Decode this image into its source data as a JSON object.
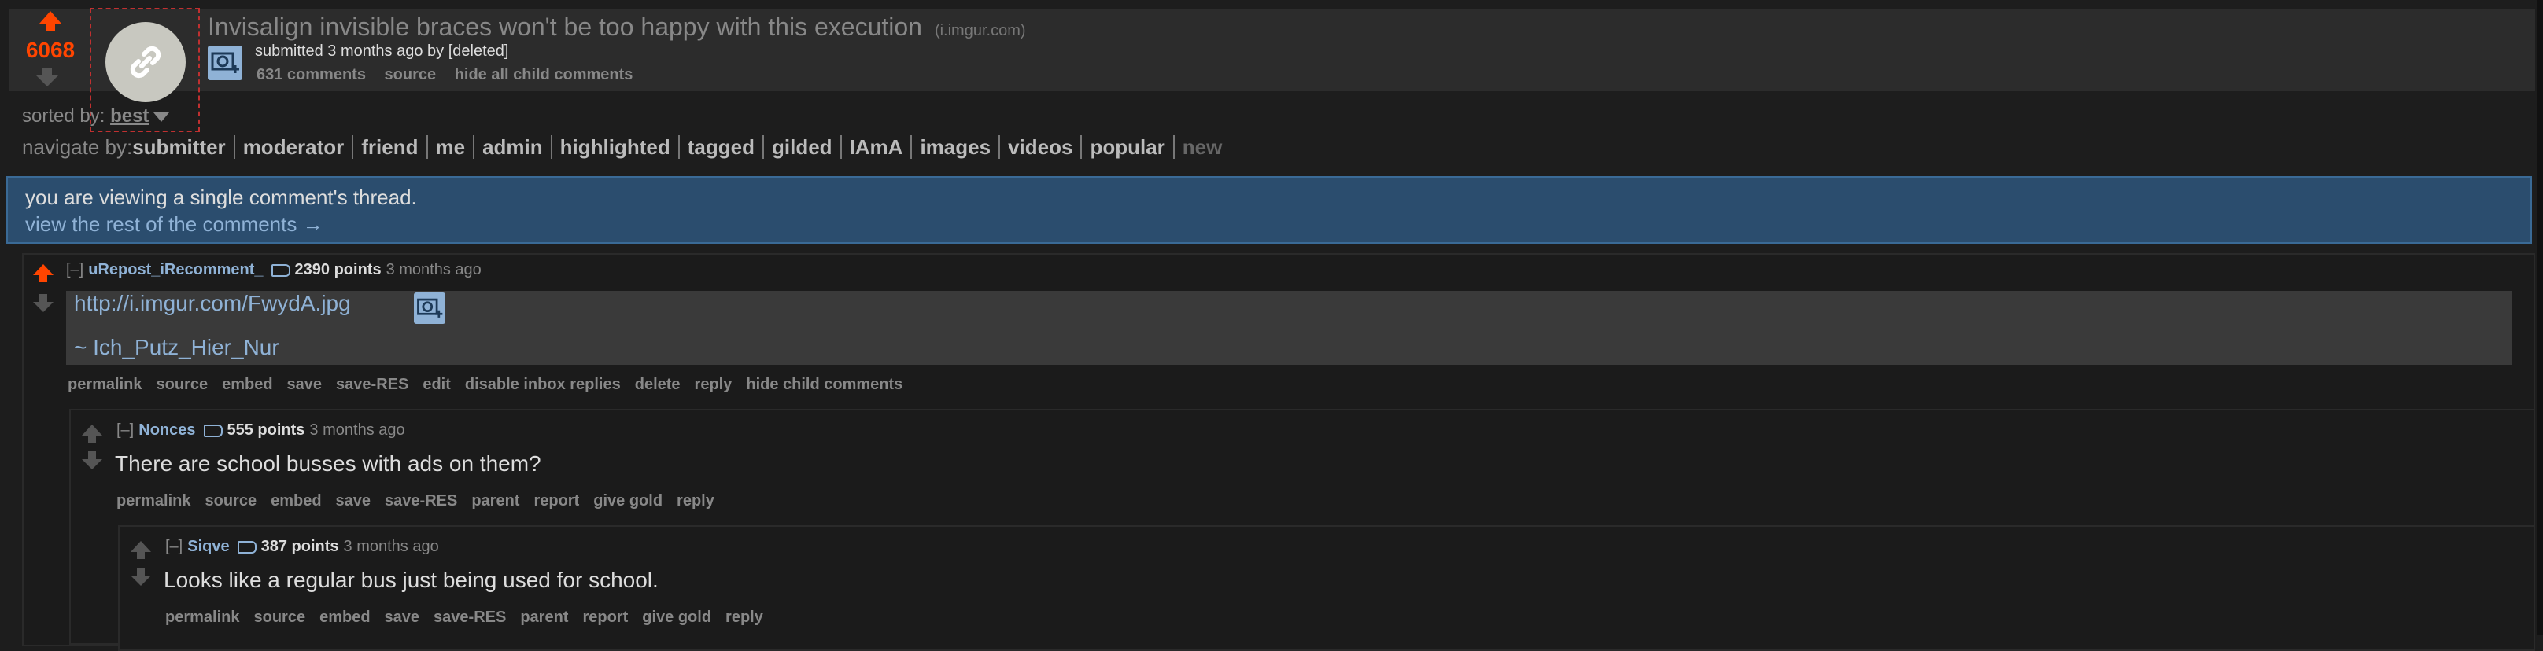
{
  "post": {
    "score": "6068",
    "title": "Invisalign invisible braces won't be too happy with this execution",
    "domain": "(i.imgur.com)",
    "tagline": "submitted 3 months ago by [deleted]",
    "buttons": [
      "631 comments",
      "source",
      "hide all child comments"
    ]
  },
  "sort": {
    "label": "sorted by:",
    "value": "best"
  },
  "navigate": {
    "label": "navigate by:",
    "items": [
      "submitter",
      "moderator",
      "friend",
      "me",
      "admin",
      "highlighted",
      "tagged",
      "gilded",
      "IAmA",
      "images",
      "videos",
      "popular",
      "new"
    ]
  },
  "banner": {
    "line1": "you are viewing a single comment's thread.",
    "line2": "view the rest of the comments →"
  },
  "comments": [
    {
      "toggle": "[–]",
      "author": "uRepost_iRecomment_",
      "points": "2390 points",
      "time": "3 months ago",
      "link": "http://i.imgur.com/FwydA.jpg",
      "signature": "~ Ich_Putz_Hier_Nur",
      "buttons": [
        "permalink",
        "source",
        "embed",
        "save",
        "save-RES",
        "edit",
        "disable inbox replies",
        "delete",
        "reply",
        "hide child comments"
      ]
    },
    {
      "toggle": "[–]",
      "author": "Nonces",
      "points": "555 points",
      "time": "3 months ago",
      "body": "There are school busses with ads on them?",
      "buttons": [
        "permalink",
        "source",
        "embed",
        "save",
        "save-RES",
        "parent",
        "report",
        "give gold",
        "reply"
      ]
    },
    {
      "toggle": "[–]",
      "author": "Siqve",
      "points": "387 points",
      "time": "3 months ago",
      "body": "Looks like a regular bus just being used for school.",
      "buttons": [
        "permalink",
        "source",
        "embed",
        "save",
        "save-RES",
        "parent",
        "report",
        "give gold",
        "reply"
      ]
    }
  ],
  "colors": {
    "upvote": "#ff4500",
    "link": "#8fb2d6",
    "banner": "#2b4d6e",
    "background": "#1d1d1d"
  },
  "icons": [
    "upvote-arrow-icon",
    "downvote-arrow-icon",
    "link-thumbnail-icon",
    "image-expando-icon",
    "user-tag-icon",
    "dropdown-caret-icon"
  ]
}
